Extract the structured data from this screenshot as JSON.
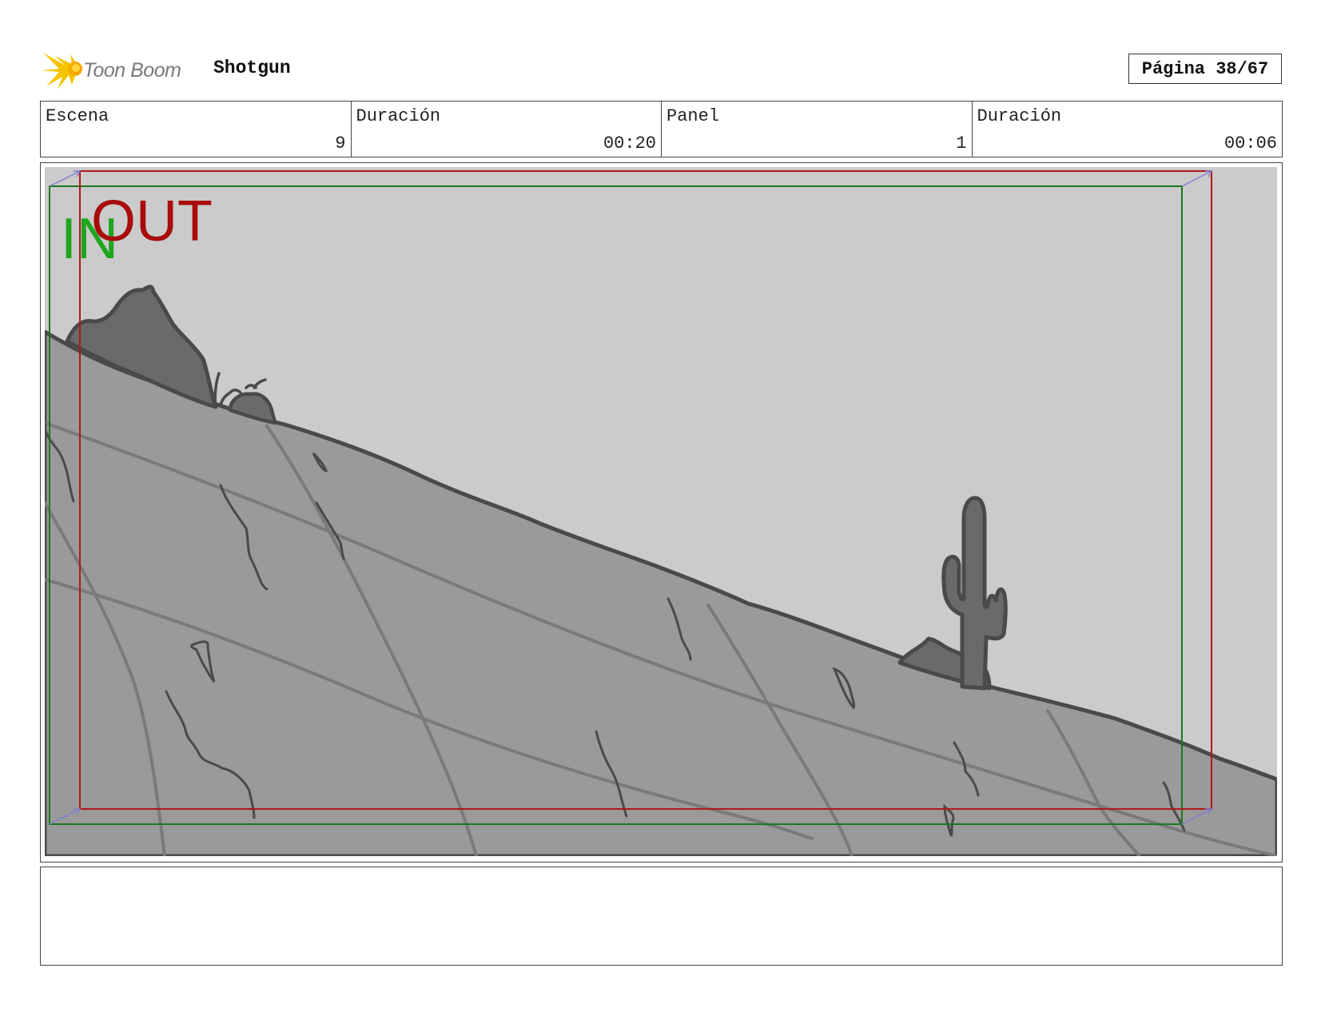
{
  "header": {
    "logo_text": "Toon Boom",
    "project_title": "Shotgun",
    "page_label": "Página 38/67"
  },
  "info": {
    "scene_label": "Escena",
    "scene_value": "9",
    "scene_duration_label": "Duración",
    "scene_duration_value": "00:20",
    "panel_label": "Panel",
    "panel_value": "1",
    "panel_duration_label": "Duración",
    "panel_duration_value": "00:06"
  },
  "panel": {
    "in_marker": "IN",
    "out_marker": "OUT",
    "colors": {
      "in_frame": "#1a7a1a",
      "in_text": "#1fa51f",
      "out_frame": "#b01818",
      "out_text": "#a80c0c",
      "sky": "#cbcbcb",
      "ground": "#9a9a9a",
      "rock": "#6a6a6a",
      "outline": "#4a4a4a"
    }
  },
  "notes": {
    "text": ""
  }
}
